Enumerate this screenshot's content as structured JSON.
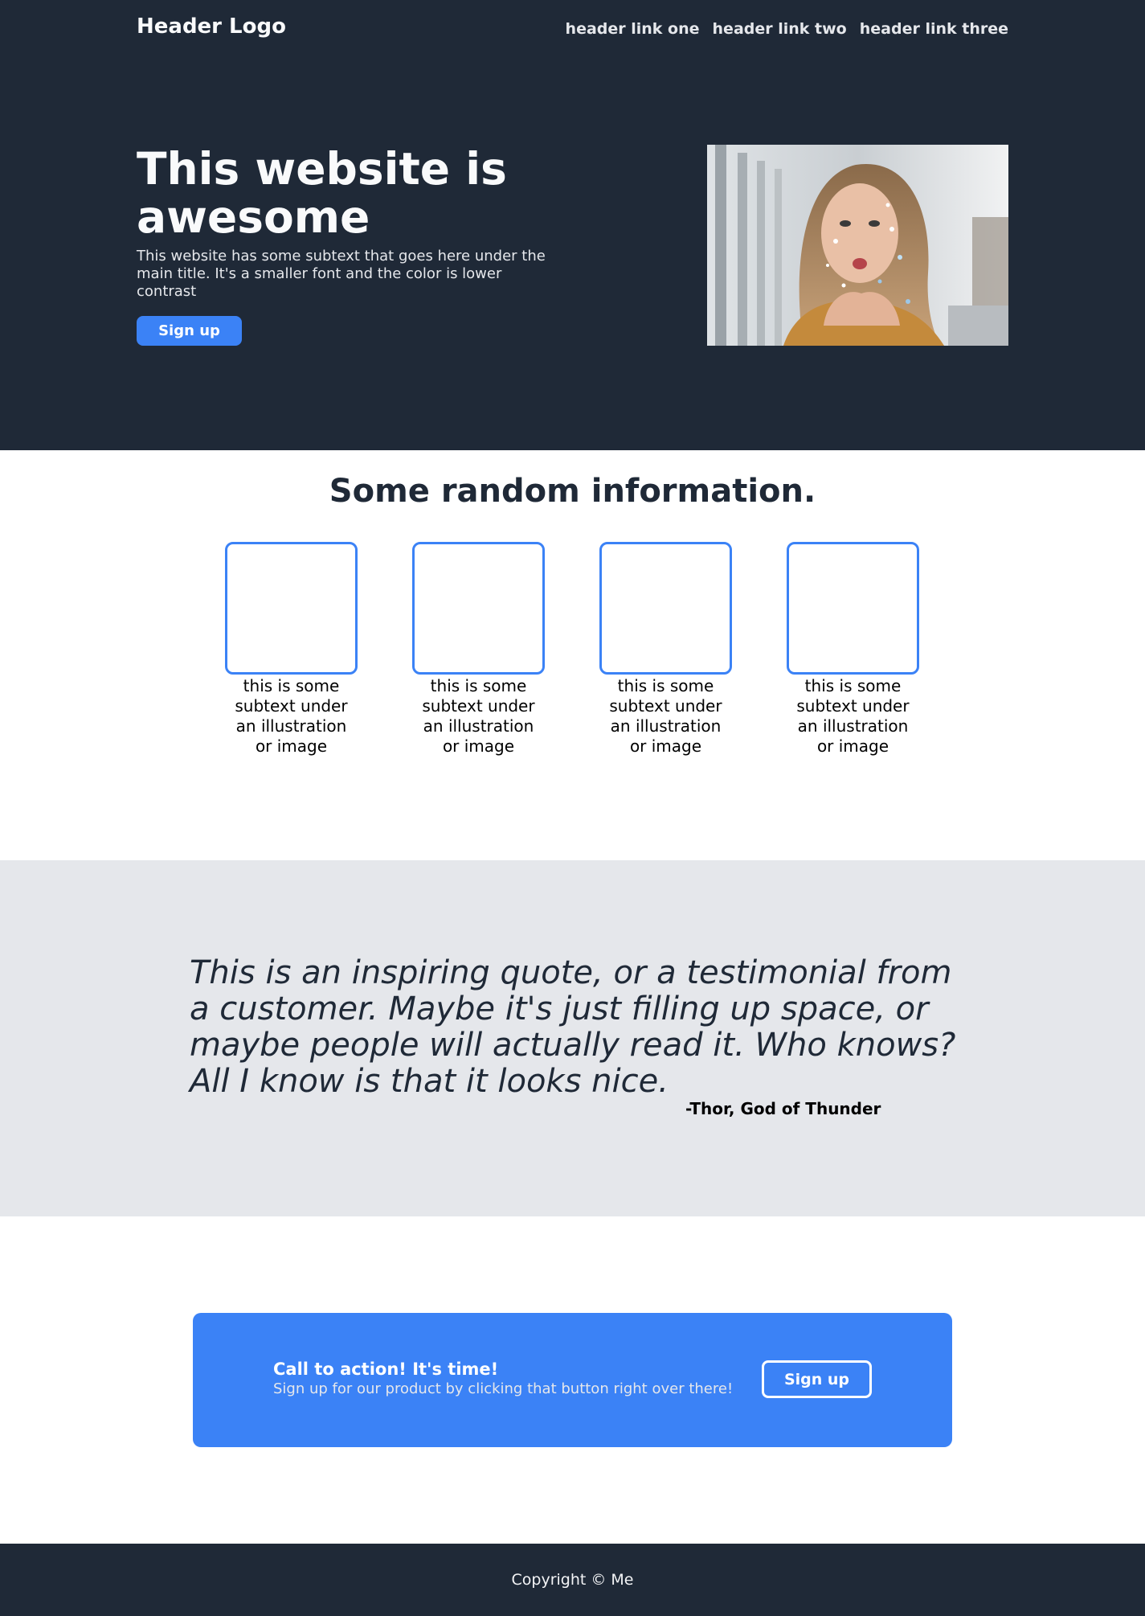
{
  "colors": {
    "dark_bg": "#1f2937",
    "accent": "#3b82f6",
    "quote_bg": "#e5e7eb",
    "white": "#ffffff"
  },
  "header": {
    "logo": "Header Logo",
    "links": [
      "header link one",
      "header link two",
      "header link three"
    ]
  },
  "hero": {
    "title": "This website is awesome",
    "subtitle": "This website has some subtext that goes here under the main title. It's a smaller font and the color is lower contrast",
    "button_label": "Sign up",
    "image": "photo of a woman blowing confetti from her hands"
  },
  "info": {
    "title": "Some random information.",
    "cards": [
      {
        "text": "this is some subtext under an illustration or image"
      },
      {
        "text": "this is some subtext under an illustration or image"
      },
      {
        "text": "this is some subtext under an illustration or image"
      },
      {
        "text": "this is some subtext under an illustration or image"
      }
    ]
  },
  "quote": {
    "text": "This is an inspiring quote, or a testimonial from a customer. Maybe it's just filling up space, or maybe people will actually read it. Who knows? All I know is that it looks nice.",
    "author": "-Thor, God of Thunder"
  },
  "cta": {
    "title": "Call to action! It's time!",
    "text": "Sign up for our product by clicking that button right over there!",
    "button_label": "Sign up"
  },
  "footer": {
    "text": "Copyright © Me"
  }
}
